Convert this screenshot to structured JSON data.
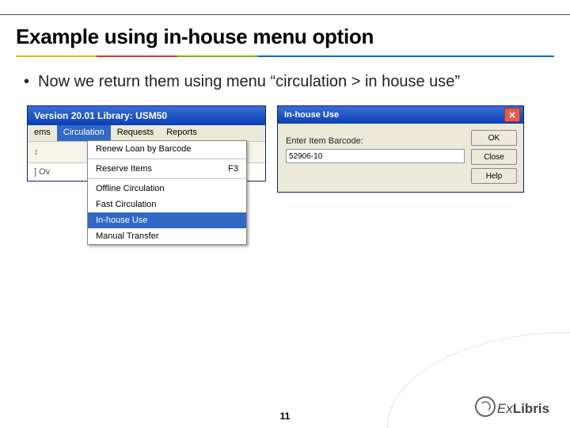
{
  "title": "Example using in-house menu option",
  "bullet": "Now we return them using menu “circulation > in house use”",
  "app": {
    "windowTitle": "Version 20.01 Library: USM50",
    "menubar": [
      "ems",
      "Circulation",
      "Requests",
      "Reports"
    ],
    "menubarOpenIndex": 1,
    "stripIconChar": "↕",
    "strip2": "] Ov",
    "dropdown": [
      {
        "label": "Renew Loan by Barcode",
        "shortcut": ""
      },
      {
        "sep": true
      },
      {
        "label": "Reserve Items",
        "shortcut": "F3"
      },
      {
        "sep": true
      },
      {
        "label": "Offline Circulation",
        "shortcut": ""
      },
      {
        "label": "Fast Circulation",
        "shortcut": ""
      },
      {
        "label": "In-house Use",
        "shortcut": "",
        "selected": true
      },
      {
        "label": "Manual Transfer",
        "shortcut": ""
      }
    ]
  },
  "dialog": {
    "title": "In-house Use",
    "label": "Enter Item Barcode:",
    "value": "52906-10",
    "buttons": [
      "OK",
      "Close",
      "Help"
    ]
  },
  "page": "11",
  "brand": {
    "part1": "Ex",
    "part2": "Libris"
  }
}
